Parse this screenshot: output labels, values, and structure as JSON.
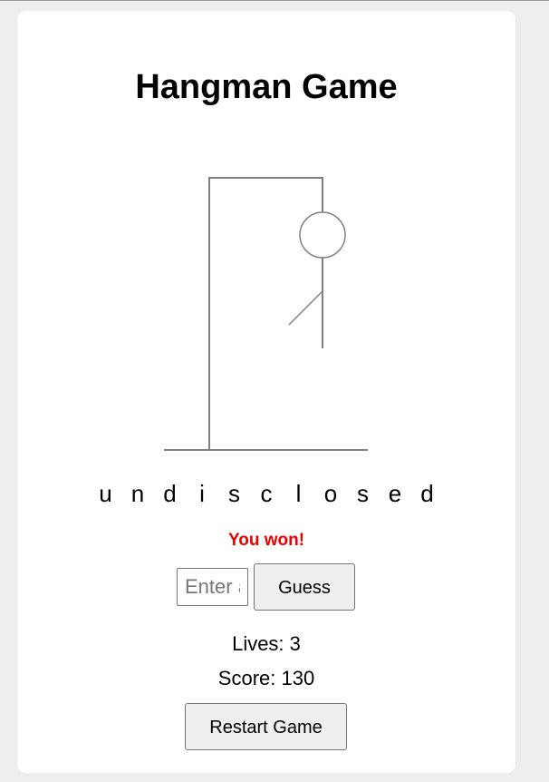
{
  "title": "Hangman Game",
  "word_letters": [
    "u",
    "n",
    "d",
    "i",
    "s",
    "c",
    "l",
    "o",
    "s",
    "e",
    "d"
  ],
  "message": "You won!",
  "guess": {
    "placeholder": "Enter a letter",
    "value": "",
    "button_label": "Guess"
  },
  "lives_text": "Lives: 3",
  "score_text": "Score: 130",
  "restart_label": "Restart Game",
  "colors": {
    "page_bg": "#eeeeee",
    "card_bg": "#ffffff",
    "gallows": "#808080",
    "message": "#ee0000",
    "button_bg": "#efefef"
  }
}
